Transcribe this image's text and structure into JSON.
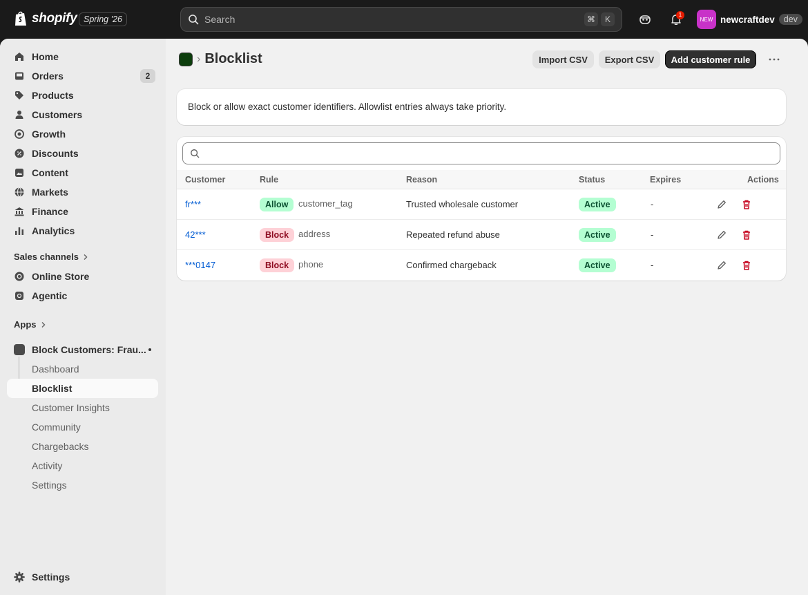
{
  "topbar": {
    "brand": "shopify",
    "version": "Spring '26",
    "search_placeholder": "Search",
    "shortcut_keys": [
      "⌘",
      "K"
    ],
    "notification_count": "1",
    "user_avatar_text": "NEW",
    "user_name": "newcraftdev",
    "user_env": "dev"
  },
  "sidebar": {
    "main_items": [
      {
        "label": "Home",
        "icon": "home-icon"
      },
      {
        "label": "Orders",
        "icon": "orders-icon",
        "count": "2"
      },
      {
        "label": "Products",
        "icon": "tag-icon"
      },
      {
        "label": "Customers",
        "icon": "person-icon"
      },
      {
        "label": "Growth",
        "icon": "growth-icon"
      },
      {
        "label": "Discounts",
        "icon": "discount-icon"
      },
      {
        "label": "Content",
        "icon": "content-icon"
      },
      {
        "label": "Markets",
        "icon": "globe-icon"
      },
      {
        "label": "Finance",
        "icon": "bank-icon"
      },
      {
        "label": "Analytics",
        "icon": "bar-chart-icon"
      }
    ],
    "sales_channels_label": "Sales channels",
    "channels": [
      {
        "label": "Online Store",
        "icon": "store-icon"
      },
      {
        "label": "Agentic",
        "icon": "agentic-icon"
      }
    ],
    "apps_label": "Apps",
    "app_name": "Block Customers: Frau...",
    "app_subitems": [
      "Dashboard",
      "Blocklist",
      "Customer Insights",
      "Community",
      "Chargebacks",
      "Activity",
      "Settings"
    ],
    "active_subitem": "Blocklist",
    "settings_label": "Settings"
  },
  "page": {
    "title": "Blocklist",
    "buttons": {
      "import": "Import CSV",
      "export": "Export CSV",
      "add": "Add customer rule"
    },
    "banner": "Block or allow exact customer identifiers. Allowlist entries always take priority."
  },
  "table": {
    "headers": [
      "Customer",
      "Rule",
      "Reason",
      "Status",
      "Expires",
      "Actions"
    ],
    "rows": [
      {
        "customer": "fr***",
        "rule": "Allow",
        "rule_type": "customer_tag",
        "reason": "Trusted wholesale customer",
        "status": "Active",
        "expires": "-"
      },
      {
        "customer": "42***",
        "rule": "Block",
        "rule_type": "address",
        "reason": "Repeated refund abuse",
        "status": "Active",
        "expires": "-"
      },
      {
        "customer": "***0147",
        "rule": "Block",
        "rule_type": "phone",
        "reason": "Confirmed chargeback",
        "status": "Active",
        "expires": "-"
      }
    ]
  },
  "colors": {
    "accent_link": "#005bd3",
    "allow_bg": "#b4fed2",
    "block_bg": "#fed1d7",
    "primary_button": "#303030"
  }
}
